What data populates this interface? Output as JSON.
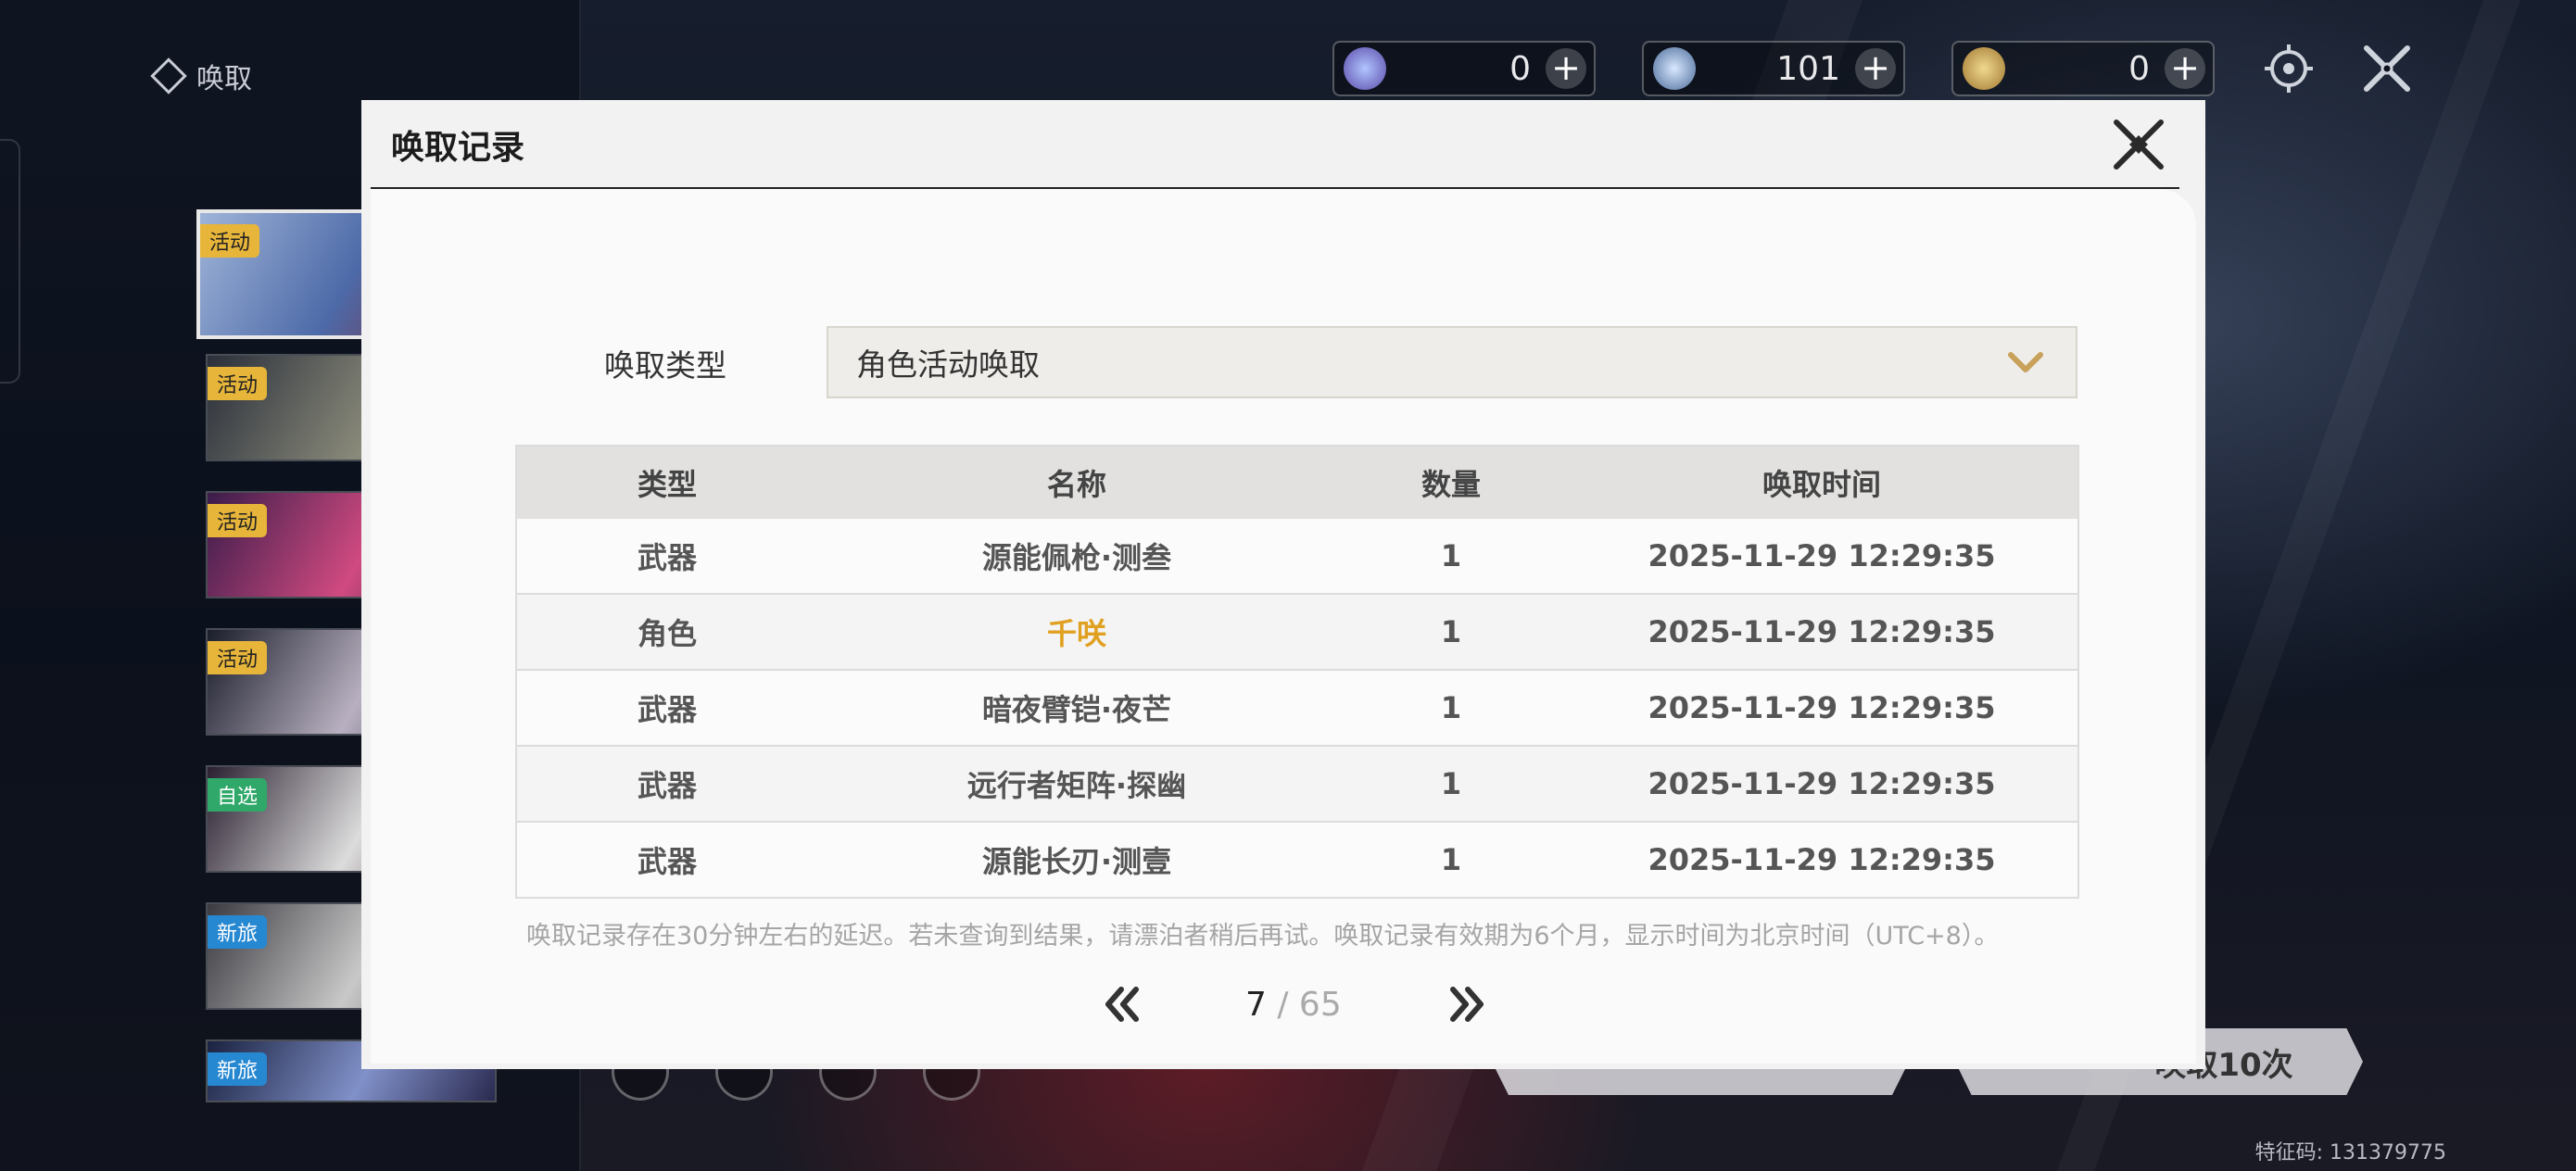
{
  "app": {
    "title": "唤取"
  },
  "currencies": [
    {
      "icon": "astrite-orb-icon",
      "value": "0",
      "plus": "+"
    },
    {
      "icon": "star-crystal-icon",
      "value": "101",
      "plus": "+"
    },
    {
      "icon": "gold-coin-icon",
      "value": "0",
      "plus": "+"
    }
  ],
  "top_icons": [
    "settings-gear-icon",
    "close-x-icon"
  ],
  "banners": [
    {
      "tag": "活动",
      "tag_color": "#e7b53a"
    },
    {
      "tag": "活动",
      "tag_color": "#e7b53a"
    },
    {
      "tag": "活动",
      "tag_color": "#e7b53a"
    },
    {
      "tag": "活动",
      "tag_color": "#e7b53a"
    },
    {
      "tag": "自选",
      "tag_color": "#2fa86a"
    },
    {
      "tag": "新旅",
      "tag_color": "#2788d2"
    },
    {
      "tag": "新旅",
      "tag_color": "#2788d2"
    }
  ],
  "bottom_buttons": {
    "pull_10": "唤取10次"
  },
  "feature_code": "特征码: 131379775",
  "modal": {
    "title": "唤取记录",
    "type_label": "唤取类型",
    "type_value": "角色活动唤取",
    "columns": [
      "类型",
      "名称",
      "数量",
      "唤取时间"
    ],
    "rows": [
      {
        "type": "武器",
        "name": "源能佩枪·测叁",
        "qty": "1",
        "time": "2025-11-29 12:29:35",
        "highlight": false
      },
      {
        "type": "角色",
        "name": "千咲",
        "qty": "1",
        "time": "2025-11-29 12:29:35",
        "highlight": true
      },
      {
        "type": "武器",
        "name": "暗夜臂铠·夜芒",
        "qty": "1",
        "time": "2025-11-29 12:29:35",
        "highlight": false
      },
      {
        "type": "武器",
        "name": "远行者矩阵·探幽",
        "qty": "1",
        "time": "2025-11-29 12:29:35",
        "highlight": false
      },
      {
        "type": "武器",
        "name": "源能长刃·测壹",
        "qty": "1",
        "time": "2025-11-29 12:29:35",
        "highlight": false
      }
    ],
    "note": "唤取记录存在30分钟左右的延迟。若未查询到结果，请漂泊者稍后再试。唤取记录有效期为6个月，显示时间为北京时间（UTC+8）。",
    "pager": {
      "current": "7",
      "separator_total": " / 65"
    },
    "accent_color": "#c8a15a",
    "highlight_color": "#e0a020"
  }
}
